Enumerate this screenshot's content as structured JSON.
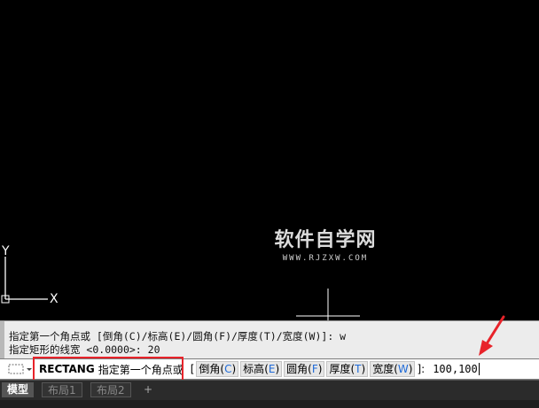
{
  "ucs": {
    "y_axis": "Y",
    "x_axis": "X"
  },
  "watermark": {
    "title": "软件自学网",
    "url": "WWW.RJZXW.COM"
  },
  "command_history": [
    "指定第一个角点或 [倒角(C)/标高(E)/圆角(F)/厚度(T)/宽度(W)]: w",
    "指定矩形的线宽 <0.0000>: 20"
  ],
  "command_line": {
    "command": "RECTANG",
    "prompt": "指定第一个角点或",
    "bracket_open": "[",
    "bracket_close": "]:",
    "options": [
      {
        "label": "倒角",
        "key": "C"
      },
      {
        "label": "标高",
        "key": "E"
      },
      {
        "label": "圆角",
        "key": "F"
      },
      {
        "label": "厚度",
        "key": "T"
      },
      {
        "label": "宽度",
        "key": "W"
      }
    ],
    "value": "100,100"
  },
  "tabs": [
    {
      "label": "模型",
      "active": true
    },
    {
      "label": "布局1",
      "active": false
    },
    {
      "label": "布局2",
      "active": false
    },
    {
      "label": "+",
      "active": false
    }
  ],
  "colors": {
    "highlight": "#e8232a",
    "option_key": "#1e6ad8",
    "canvas": "#000000"
  }
}
